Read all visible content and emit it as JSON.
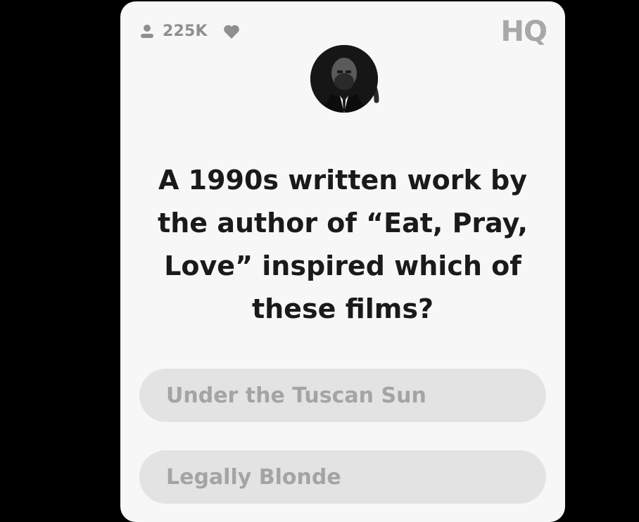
{
  "header": {
    "viewer_count": "225K",
    "logo_text": "HQ",
    "viewers_icon": "person-icon",
    "lives_icon": "heart-icon"
  },
  "host": {
    "avatar_icon": "host-avatar",
    "timer_icon": "countdown-ring"
  },
  "question": {
    "text": "A 1990s written work by\nthe author of “Eat, Pray,\nLove” inspired which of\nthese films?"
  },
  "answers": [
    {
      "label": "Under the Tuscan Sun"
    },
    {
      "label": "Legally Blonde"
    }
  ],
  "colors": {
    "card_background": "#f7f7f7",
    "answer_background": "#e3e3e3",
    "answer_text": "#a4a4a4",
    "question_text": "#1a1a1a",
    "page_background": "#000000"
  }
}
